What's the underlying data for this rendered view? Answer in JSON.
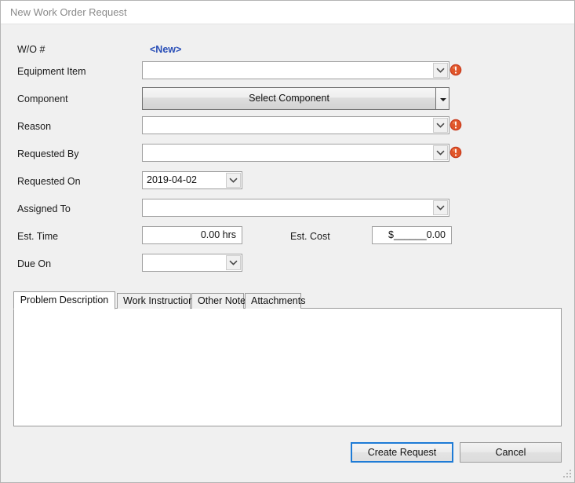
{
  "window": {
    "title": "New Work Order Request"
  },
  "form": {
    "wo": {
      "label": "W/O #",
      "value": "<New>"
    },
    "equipment_item": {
      "label": "Equipment Item",
      "value": "",
      "has_error": true,
      "error_icon": "error-exclamation-icon"
    },
    "component": {
      "label": "Component",
      "button_label": "Select Component"
    },
    "reason": {
      "label": "Reason",
      "value": "",
      "has_error": true,
      "error_icon": "error-exclamation-icon"
    },
    "requested_by": {
      "label": "Requested By",
      "value": "",
      "has_error": true,
      "error_icon": "error-exclamation-icon"
    },
    "requested_on": {
      "label": "Requested On",
      "value": "2019-04-02"
    },
    "assigned_to": {
      "label": "Assigned To",
      "value": ""
    },
    "est_time": {
      "label": "Est. Time",
      "value": "0.00 hrs"
    },
    "est_cost": {
      "label": "Est. Cost",
      "value": "$______0.00"
    },
    "due_on": {
      "label": "Due On",
      "value": ""
    }
  },
  "tabs": {
    "active_index": 0,
    "items": [
      {
        "label": "Problem Description"
      },
      {
        "label": "Work Instructions"
      },
      {
        "label": "Other Notes"
      },
      {
        "label": "Attachments"
      }
    ],
    "content": ""
  },
  "buttons": {
    "primary": "Create Request",
    "secondary": "Cancel"
  },
  "colors": {
    "accent": "#2a4fb7",
    "default_button_border": "#1e7bd6",
    "error": "#d8401a",
    "window_bg": "#f0f0f0",
    "title_text": "#8a8a8a"
  }
}
